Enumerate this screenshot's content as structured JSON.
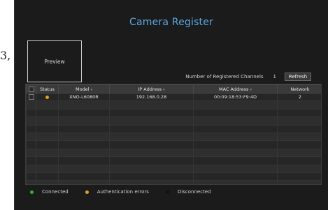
{
  "page": {
    "fragment_text": "3,"
  },
  "dialog": {
    "title": "Camera Register",
    "preview_label": "Preview",
    "registered_channels_label": "Number of Registered Channels",
    "registered_channels_count": "1",
    "refresh_label": "Refresh"
  },
  "table": {
    "columns": [
      "Status",
      "Model",
      "IP Address",
      "MAC Address",
      "Network"
    ],
    "rows": [
      {
        "status": "auth_error",
        "model": "XNO-L6080R",
        "ip": "192.168.0.28",
        "mac": "00:09:18:53:F9:4D",
        "network": "2"
      }
    ],
    "empty_rows": 11
  },
  "legend": [
    {
      "label": "Connected",
      "color": "#2db52d"
    },
    {
      "label": "Authentication errors",
      "color": "#e0a020"
    },
    {
      "label": "Disconnected",
      "color": "#111111"
    }
  ],
  "status_colors": {
    "auth_error": "#e0a020",
    "connected": "#2db52d",
    "disconnected": "#111111"
  }
}
